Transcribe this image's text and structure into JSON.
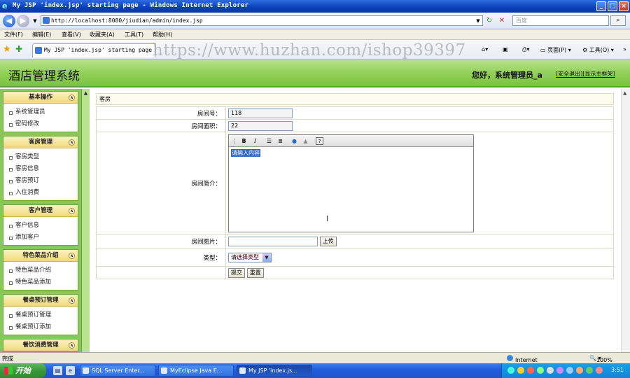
{
  "window": {
    "title": "My JSP 'index.jsp' starting page - Windows Internet Explorer",
    "min": "_",
    "max": "□",
    "close": "×"
  },
  "address": {
    "url": "http://localhost:8080/jiudian/admin/index.jsp",
    "search_placeholder": "百度"
  },
  "menu": [
    "文件(F)",
    "编辑(E)",
    "查看(V)",
    "收藏夹(A)",
    "工具(T)",
    "帮助(H)"
  ],
  "tab": {
    "label": "My JSP 'index.jsp' starting page"
  },
  "watermark": "https://www.huzhan.com/ishop39397",
  "commands": {
    "page": "页面(P)",
    "tools": "工具(O)"
  },
  "header": {
    "title": "酒店管理系统",
    "greeting": "您好，系统管理员_a",
    "logout": "[安全退出]",
    "home": "[显示主框架]"
  },
  "sidebar": {
    "groups": [
      {
        "title": "基本操作",
        "items": [
          "系统管理员",
          "密码修改"
        ]
      },
      {
        "title": "客房管理",
        "items": [
          "客房类型",
          "客房信息",
          "客房预订",
          "入住消费"
        ]
      },
      {
        "title": "客户管理",
        "items": [
          "客户信息",
          "添加客户"
        ]
      },
      {
        "title": "特色菜品介绍",
        "items": [
          "特色菜品介绍",
          "特色菜品添加"
        ]
      },
      {
        "title": "餐桌预订管理",
        "items": [
          "餐桌预订管理",
          "餐桌预订添加"
        ]
      },
      {
        "title": "餐饮消费管理",
        "items": []
      }
    ]
  },
  "main": {
    "breadcrumb": "客房",
    "form": {
      "room_no_label": "房间号：",
      "room_no_value": "118",
      "area_label": "房间面积：",
      "area_value": "22",
      "desc_label": "房间简介：",
      "desc_text": "请输入内容",
      "photo_label": "房间图片：",
      "upload_label": "上传",
      "type_label": "类型：",
      "type_selected": "请选择类型",
      "submit_label": "提交",
      "reset_label": "重置"
    }
  },
  "status": {
    "left": "完成",
    "zone": "Internet",
    "zoom": "100%"
  },
  "taskbar": {
    "start": "开始",
    "tasks": [
      "SQL Server Enter...",
      "MyEclipse Java E...",
      "My JSP 'index.js..."
    ],
    "clock": "3:51"
  }
}
